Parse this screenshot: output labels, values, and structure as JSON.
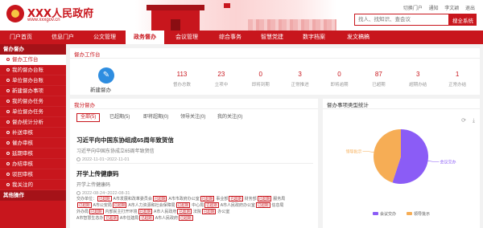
{
  "header": {
    "site_name": "XXX人民政府",
    "site_url": "www.xxxgov.cn",
    "top_links": [
      "切换门户",
      "通知",
      "李文颖",
      "退出"
    ],
    "search_placeholder": "找人、找知识、查会议",
    "search_button": "搜全系统"
  },
  "nav": {
    "items": [
      {
        "label": "门户首页",
        "active": false,
        "w": 52
      },
      {
        "label": "信息门户",
        "active": false,
        "w": 52
      },
      {
        "label": "公文管理",
        "active": false,
        "w": 52
      },
      {
        "label": "政务督办",
        "active": true,
        "w": 48
      },
      {
        "label": "会议管理",
        "active": false,
        "w": 56
      },
      {
        "label": "综合事务",
        "active": false,
        "w": 52
      },
      {
        "label": "智慧党建",
        "active": false,
        "w": 52
      },
      {
        "label": "数字档案",
        "active": false,
        "w": 52
      },
      {
        "label": "发文稿稿",
        "active": false,
        "w": 58
      }
    ]
  },
  "sidebar": {
    "group_title": "督办督办",
    "items": [
      {
        "label": "督办工作台",
        "active": true
      },
      {
        "label": "我的督办台账",
        "active": false
      },
      {
        "label": "单位督办台账",
        "active": false
      },
      {
        "label": "新建督办事项",
        "active": false
      },
      {
        "label": "我的督办任务",
        "active": false
      },
      {
        "label": "单位督办任务",
        "active": false
      },
      {
        "label": "督办统计分析",
        "active": false
      },
      {
        "label": "补送审核",
        "active": false
      },
      {
        "label": "催办审核",
        "active": false
      },
      {
        "label": "延期审核",
        "active": false
      },
      {
        "label": "办结审核",
        "active": false
      },
      {
        "label": "驳回审核",
        "active": false
      },
      {
        "label": "我关注的",
        "active": false
      }
    ],
    "footer_group": "其他操作"
  },
  "workbench": {
    "title": "督办工作台",
    "new_label": "新建督办",
    "stats": [
      {
        "value": "113",
        "label": "督办总数"
      },
      {
        "value": "23",
        "label": "立项中"
      },
      {
        "value": "0",
        "label": "即将到期"
      },
      {
        "value": "3",
        "label": "正常推进"
      },
      {
        "value": "0",
        "label": "即将逾期"
      },
      {
        "value": "87",
        "label": "已超期"
      },
      {
        "value": "3",
        "label": "超期办结"
      },
      {
        "value": "1",
        "label": "正常办结"
      }
    ]
  },
  "mine": {
    "title": "我分督办",
    "tabs": [
      {
        "label": "全部(5)",
        "active": true
      },
      {
        "label": "已超期(5)",
        "active": false
      },
      {
        "label": "即将超期(0)",
        "active": false
      },
      {
        "label": "领导关注(0)",
        "active": false
      },
      {
        "label": "我的关注(0)",
        "active": false
      }
    ],
    "items": [
      {
        "title": "习近平向中国东协组成65周年致贺信",
        "subtitle": "习近平向中国东协成立65周年致贺信",
        "date": "2022-11-01~2022-11-01"
      },
      {
        "title": "开学上传健康码",
        "subtitle": "开学上传健康码",
        "date": "2022-08-24~2022-08-31"
      }
    ],
    "dept_rows": [
      [
        {
          "text": "交办单位："
        },
        {
          "text": "已超期",
          "tag": true
        },
        {
          "text": "A市发展和改革委员会"
        },
        {
          "text": "已超期",
          "tag": true
        },
        {
          "text": "A市市政府办公室"
        },
        {
          "text": "已超期",
          "tag": true
        },
        {
          "text": "事业部"
        },
        {
          "text": "已超期",
          "tag": true
        },
        {
          "text": "财务部"
        },
        {
          "text": "已超期",
          "tag": true
        },
        {
          "text": "服务局"
        }
      ],
      [
        {
          "text": "已超期",
          "tag": true
        },
        {
          "text": "A市公安局"
        },
        {
          "text": "已超期",
          "tag": true
        },
        {
          "text": "A市人力资源和社会保障局"
        },
        {
          "text": "已超期",
          "tag": true
        },
        {
          "text": "中心局"
        },
        {
          "text": "已超期",
          "tag": true
        },
        {
          "text": "A市人民政府办公室"
        },
        {
          "text": "已超期",
          "tag": true
        },
        {
          "text": "信息局"
        }
      ],
      [
        {
          "text": "外办局"
        },
        {
          "text": "已超期",
          "tag": true
        },
        {
          "text": "内部民主打开环境"
        },
        {
          "text": "已超期",
          "tag": true
        },
        {
          "text": "A市人民政府"
        },
        {
          "text": "已超期",
          "tag": true
        },
        {
          "text": "法院"
        },
        {
          "text": "已超期",
          "tag": true
        },
        {
          "text": "办公室"
        }
      ],
      [
        {
          "text": "A市智慧生态办"
        },
        {
          "text": "已超期",
          "tag": true
        },
        {
          "text": "A市住建局"
        },
        {
          "text": "已超期",
          "tag": true
        },
        {
          "text": "A市人民政府"
        },
        {
          "text": "已超期",
          "tag": true
        }
      ]
    ]
  },
  "chart_data": {
    "type": "pie",
    "title": "督办事项类型统计",
    "series": [
      {
        "name": "会议交办",
        "value": 55,
        "color": "#8b5cf6"
      },
      {
        "name": "领导批示",
        "value": 45,
        "color": "#f6ad55"
      }
    ],
    "legend_placement": "bottom",
    "tool_icons": [
      "refresh-icon",
      "download-icon"
    ]
  }
}
